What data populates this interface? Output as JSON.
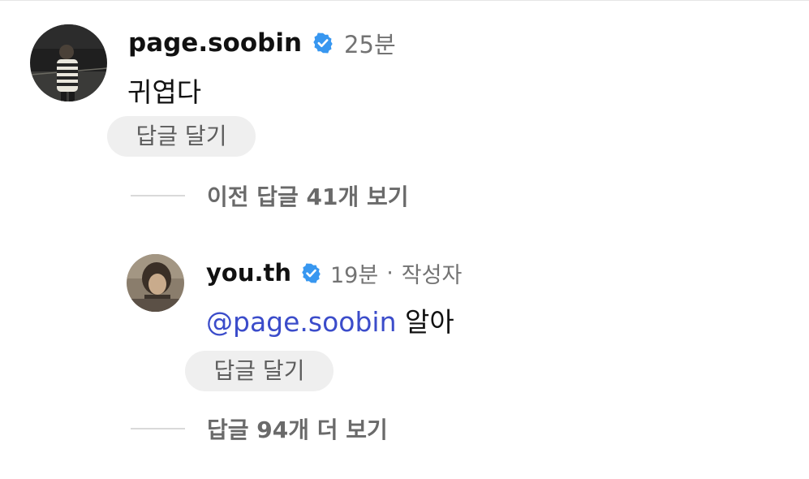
{
  "comment": {
    "username": "page.soobin",
    "time": "25분",
    "text": "귀엽다",
    "reply_button": "답글 달기"
  },
  "view_previous_replies": "이전 답글 41개 보기",
  "reply": {
    "username": "you.th",
    "time": "19분",
    "separator": "·",
    "author_tag": "작성자",
    "mention": "@page.soobin",
    "text": "알아",
    "reply_button": "답글 달기"
  },
  "view_more_replies": "답글 94개 더 보기",
  "colors": {
    "verified_badge": "#3897f0",
    "mention": "#3b4cca",
    "secondary_text": "#737373",
    "pill_background": "#efefef"
  },
  "icons": {
    "verified": "verified-badge-icon"
  }
}
